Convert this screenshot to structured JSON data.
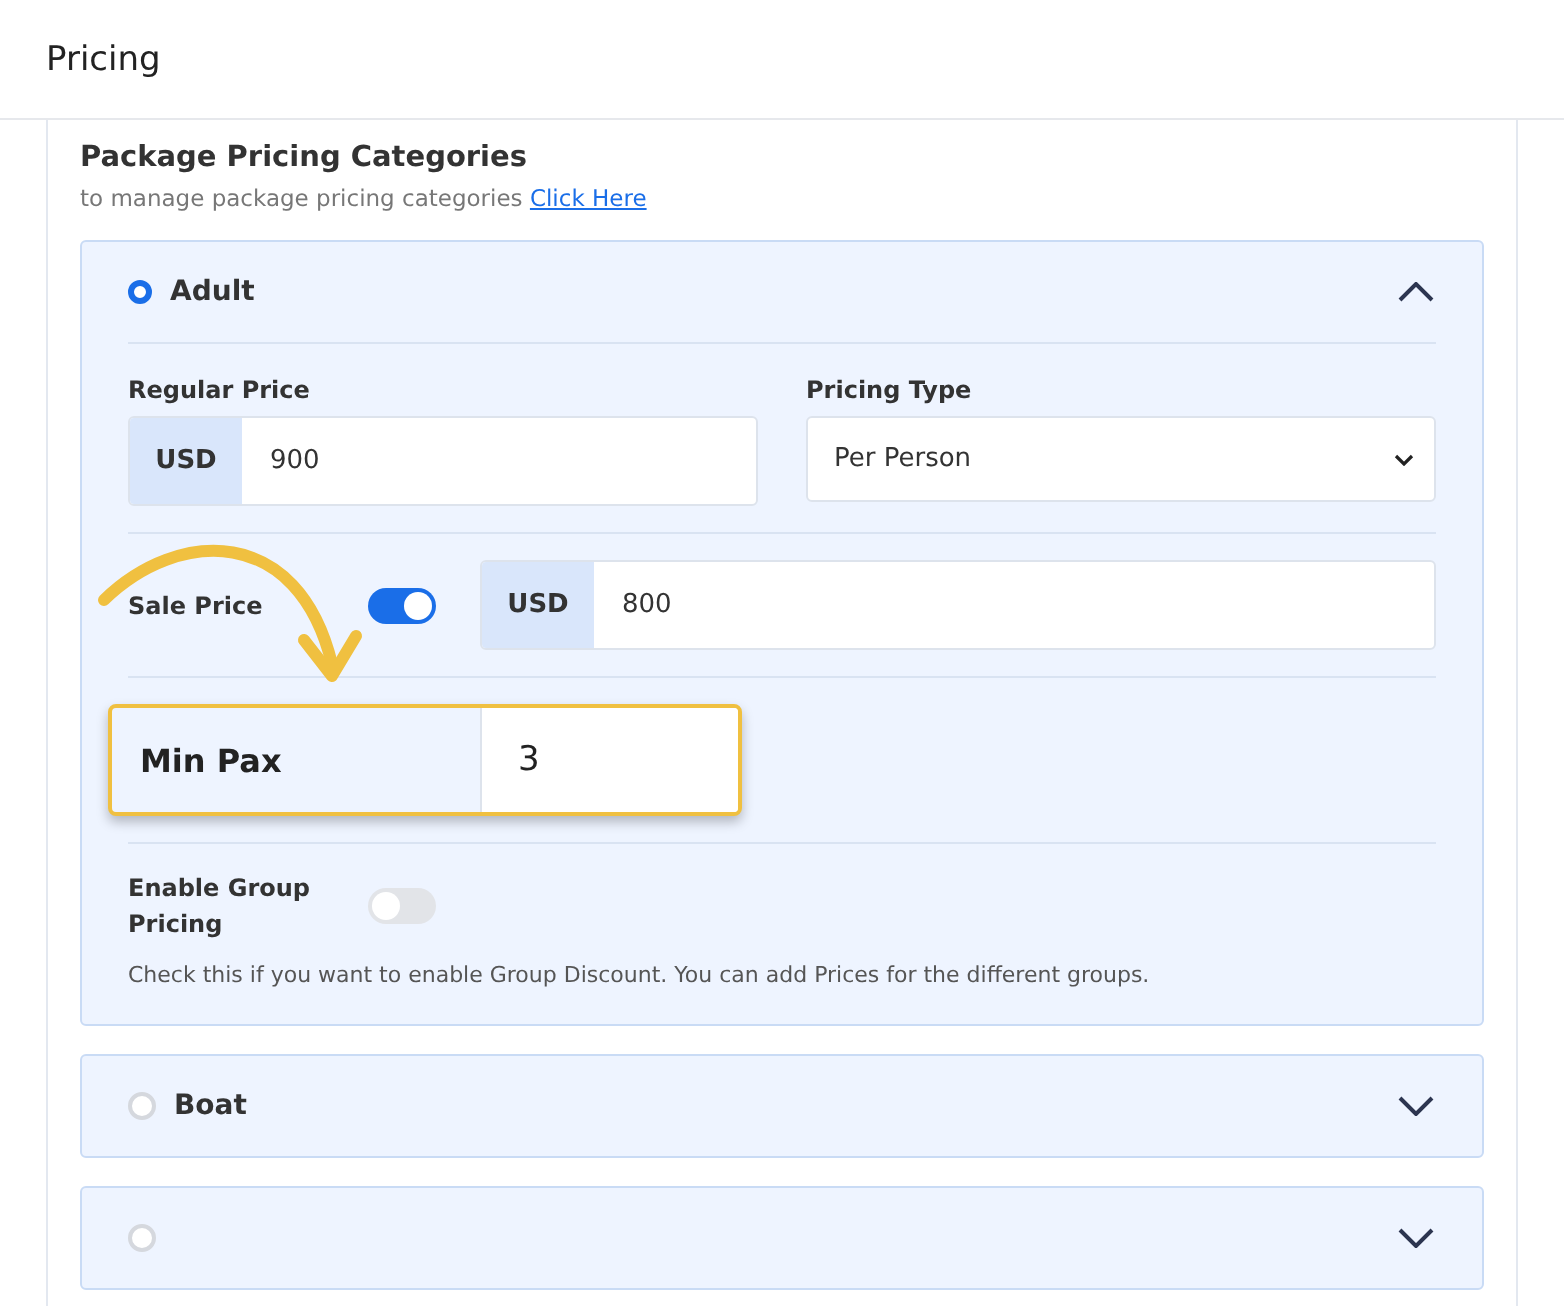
{
  "header": {
    "title": "Pricing"
  },
  "section": {
    "title": "Package Pricing Categories",
    "note": "to manage package pricing categories",
    "link": "Click Here"
  },
  "categories": [
    {
      "name": "Adult",
      "selected": true,
      "expanded": true,
      "regular_price": {
        "label": "Regular Price",
        "currency": "USD",
        "value": "900"
      },
      "pricing_type": {
        "label": "Pricing Type",
        "value": "Per Person"
      },
      "sale_price": {
        "label": "Sale Price",
        "on": true,
        "currency": "USD",
        "value": "800"
      },
      "min_pax": {
        "label": "Min Pax",
        "value": "3"
      },
      "group_pricing": {
        "label": "Enable Group Pricing",
        "on": false,
        "help": "Check this if you want to enable Group Discount. You can add Prices for the different groups."
      }
    },
    {
      "name": "Boat",
      "selected": false,
      "expanded": false
    },
    {
      "selected": false,
      "expanded": false
    }
  ]
}
